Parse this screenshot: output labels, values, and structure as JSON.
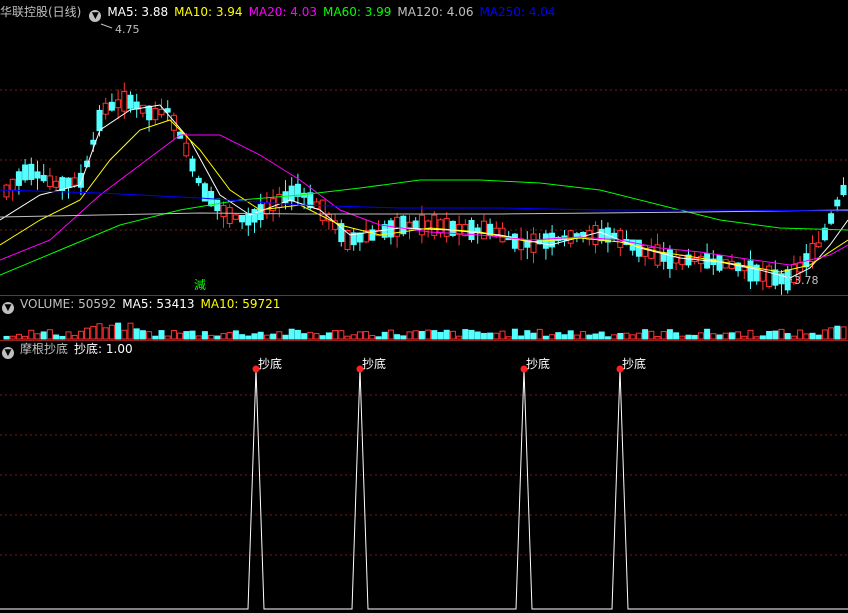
{
  "main_header": {
    "stock_name": "华联控股(日线)",
    "ma5": "MA5: 3.88",
    "ma10": "MA10: 3.94",
    "ma20": "MA20: 4.03",
    "ma60": "MA60: 3.99",
    "ma120": "MA120: 4.06",
    "ma250": "MA250: 4.04"
  },
  "main_annotations": {
    "high_label": "4.75",
    "low_label": "3.78",
    "reduce_label": "減"
  },
  "volume_header": {
    "volume": "VOLUME: 50592",
    "ma5": "MA5: 53413",
    "ma10": "MA10: 59721"
  },
  "indicator_header": {
    "name": "摩根抄底",
    "value": "抄底: 1.00"
  },
  "indicator_signals": [
    "抄底",
    "抄底",
    "抄底",
    "抄底"
  ],
  "colors": {
    "up": "#ff3232",
    "down": "#54ffff",
    "ma5": "#ffffff",
    "ma10": "#ffff00",
    "ma20": "#ff00ff",
    "ma60": "#00ff00",
    "ma120": "#c0c0c0",
    "ma250": "#0000ff",
    "grid": "#7a1818",
    "separator": "#9a1f1f"
  },
  "chart_data": {
    "type": "candlestick",
    "price_range": [
      3.78,
      4.75
    ],
    "indicator_range": [
      0,
      1
    ],
    "signal_count": 4
  }
}
